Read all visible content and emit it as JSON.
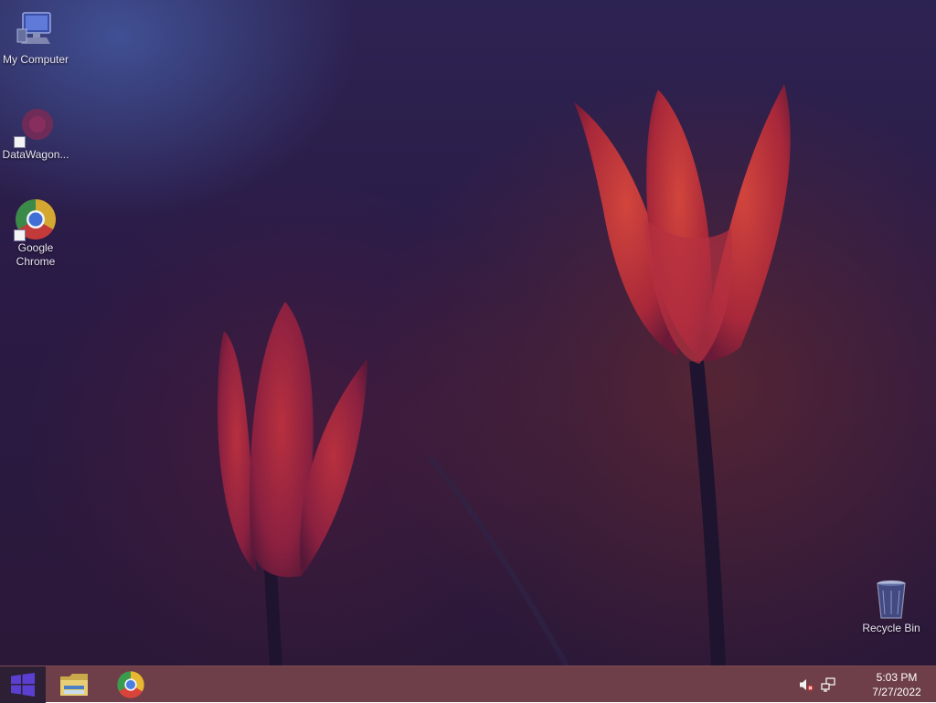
{
  "desktop": {
    "icons": [
      {
        "label": "My Computer",
        "icon": "computer-icon"
      },
      {
        "label": "DataWagon...",
        "icon": "datawagon-icon",
        "shortcut": true
      },
      {
        "label": "Google Chrome",
        "icon": "chrome-icon",
        "shortcut": true
      },
      {
        "label": "Recycle Bin",
        "icon": "recycle-bin-icon"
      }
    ]
  },
  "taskbar": {
    "start": {
      "icon": "windows-logo-icon",
      "color": "#5a3fd0"
    },
    "pinned": [
      {
        "name": "File Explorer",
        "icon": "folder-icon"
      },
      {
        "name": "Google Chrome",
        "icon": "chrome-icon"
      }
    ],
    "tray": {
      "volume_icon": "volume-muted-icon",
      "network_icon": "network-icon",
      "time": "5:03 PM",
      "date": "7/27/2022"
    }
  },
  "colors": {
    "taskbar": "#6e3f48",
    "start_bg": "#2e2034",
    "tulip": "#c23a3a"
  }
}
